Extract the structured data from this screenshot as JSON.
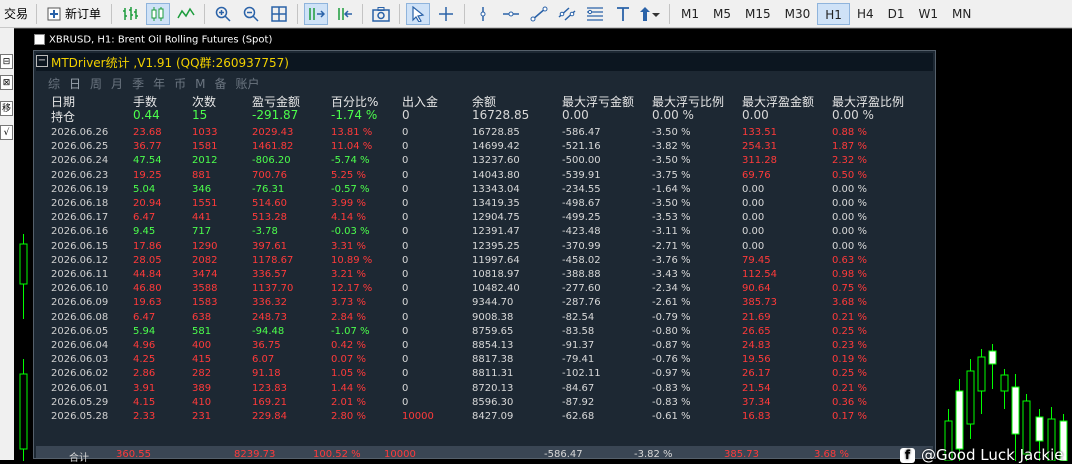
{
  "toolbar": {
    "trade_label": "交易",
    "new_order_label": "新订单",
    "timeframes": [
      "M1",
      "M5",
      "M15",
      "M30",
      "H1",
      "H4",
      "D1",
      "W1",
      "MN"
    ],
    "active_timeframe": "H1"
  },
  "left_strip": {
    "buttons": [
      "⊟",
      "⊠",
      "移",
      "√"
    ]
  },
  "chart": {
    "title": "XBRUSD, H1:  Brent Oil Rolling Futures (Spot)",
    "candle_up_color": "#00ff00",
    "candle_body_fill": "#ffffff"
  },
  "panel": {
    "title": "MTDriver统计 ,V1.91 (QQ群:260937757)",
    "tabs": [
      "综",
      "日",
      "周",
      "月",
      "季",
      "年",
      "币",
      "M",
      "备",
      "账户"
    ],
    "active_tab": "日",
    "headers": [
      "日期",
      "手数",
      "次数",
      "盈亏金额",
      "百分比%",
      "出入金",
      "余额",
      "最大浮亏金额",
      "最大浮亏比例",
      "最大浮盈金额",
      "最大浮盈比例"
    ],
    "holding": {
      "label": "持仓",
      "lots": "0.44",
      "trades": "15",
      "pnl": "-291.87",
      "pct": "-1.74 %",
      "deposit": "0",
      "balance": "16728.85",
      "max_loss": "0.00",
      "max_loss_pct": "0.00 %",
      "max_profit": "0.00",
      "max_profit_pct": "0.00 %"
    },
    "rows": [
      {
        "date": "2026.06.26",
        "lots": "23.68",
        "trades": "1033",
        "pnl": "2029.43",
        "pct": "13.81 %",
        "deposit": "0",
        "balance": "16728.85",
        "max_loss": "-586.47",
        "max_loss_pct": "-3.50 %",
        "max_profit": "133.51",
        "max_profit_pct": "0.88 %",
        "positive": true
      },
      {
        "date": "2026.06.25",
        "lots": "36.77",
        "trades": "1581",
        "pnl": "1461.82",
        "pct": "11.04 %",
        "deposit": "0",
        "balance": "14699.42",
        "max_loss": "-521.16",
        "max_loss_pct": "-3.82 %",
        "max_profit": "254.31",
        "max_profit_pct": "1.87 %",
        "positive": true
      },
      {
        "date": "2026.06.24",
        "lots": "47.54",
        "trades": "2012",
        "pnl": "-806.20",
        "pct": "-5.74 %",
        "deposit": "0",
        "balance": "13237.60",
        "max_loss": "-500.00",
        "max_loss_pct": "-3.50 %",
        "max_profit": "311.28",
        "max_profit_pct": "2.32 %",
        "positive": false
      },
      {
        "date": "2026.06.23",
        "lots": "19.25",
        "trades": "881",
        "pnl": "700.76",
        "pct": "5.25 %",
        "deposit": "0",
        "balance": "14043.80",
        "max_loss": "-539.91",
        "max_loss_pct": "-3.75 %",
        "max_profit": "69.76",
        "max_profit_pct": "0.50 %",
        "positive": true
      },
      {
        "date": "2026.06.19",
        "lots": "5.04",
        "trades": "346",
        "pnl": "-76.31",
        "pct": "-0.57 %",
        "deposit": "0",
        "balance": "13343.04",
        "max_loss": "-234.55",
        "max_loss_pct": "-1.64 %",
        "max_profit": "0.00",
        "max_profit_pct": "0.00 %",
        "positive": false
      },
      {
        "date": "2026.06.18",
        "lots": "20.94",
        "trades": "1551",
        "pnl": "514.60",
        "pct": "3.99 %",
        "deposit": "0",
        "balance": "13419.35",
        "max_loss": "-498.67",
        "max_loss_pct": "-3.50 %",
        "max_profit": "0.00",
        "max_profit_pct": "0.00 %",
        "positive": true
      },
      {
        "date": "2026.06.17",
        "lots": "6.47",
        "trades": "441",
        "pnl": "513.28",
        "pct": "4.14 %",
        "deposit": "0",
        "balance": "12904.75",
        "max_loss": "-499.25",
        "max_loss_pct": "-3.53 %",
        "max_profit": "0.00",
        "max_profit_pct": "0.00 %",
        "positive": true
      },
      {
        "date": "2026.06.16",
        "lots": "9.45",
        "trades": "717",
        "pnl": "-3.78",
        "pct": "-0.03 %",
        "deposit": "0",
        "balance": "12391.47",
        "max_loss": "-423.48",
        "max_loss_pct": "-3.11 %",
        "max_profit": "0.00",
        "max_profit_pct": "0.00 %",
        "positive": false
      },
      {
        "date": "2026.06.15",
        "lots": "17.86",
        "trades": "1290",
        "pnl": "397.61",
        "pct": "3.31 %",
        "deposit": "0",
        "balance": "12395.25",
        "max_loss": "-370.99",
        "max_loss_pct": "-2.71 %",
        "max_profit": "0.00",
        "max_profit_pct": "0.00 %",
        "positive": true
      },
      {
        "date": "2026.06.12",
        "lots": "28.05",
        "trades": "2082",
        "pnl": "1178.67",
        "pct": "10.89 %",
        "deposit": "0",
        "balance": "11997.64",
        "max_loss": "-458.02",
        "max_loss_pct": "-3.76 %",
        "max_profit": "79.45",
        "max_profit_pct": "0.63 %",
        "positive": true
      },
      {
        "date": "2026.06.11",
        "lots": "44.84",
        "trades": "3474",
        "pnl": "336.57",
        "pct": "3.21 %",
        "deposit": "0",
        "balance": "10818.97",
        "max_loss": "-388.88",
        "max_loss_pct": "-3.43 %",
        "max_profit": "112.54",
        "max_profit_pct": "0.98 %",
        "positive": true
      },
      {
        "date": "2026.06.10",
        "lots": "46.80",
        "trades": "3588",
        "pnl": "1137.70",
        "pct": "12.17 %",
        "deposit": "0",
        "balance": "10482.40",
        "max_loss": "-277.60",
        "max_loss_pct": "-2.34 %",
        "max_profit": "90.64",
        "max_profit_pct": "0.75 %",
        "positive": true
      },
      {
        "date": "2026.06.09",
        "lots": "19.63",
        "trades": "1583",
        "pnl": "336.32",
        "pct": "3.73 %",
        "deposit": "0",
        "balance": "9344.70",
        "max_loss": "-287.76",
        "max_loss_pct": "-2.61 %",
        "max_profit": "385.73",
        "max_profit_pct": "3.68 %",
        "positive": true
      },
      {
        "date": "2026.06.08",
        "lots": "6.47",
        "trades": "638",
        "pnl": "248.73",
        "pct": "2.84 %",
        "deposit": "0",
        "balance": "9008.38",
        "max_loss": "-82.54",
        "max_loss_pct": "-0.79 %",
        "max_profit": "21.69",
        "max_profit_pct": "0.21 %",
        "positive": true
      },
      {
        "date": "2026.06.05",
        "lots": "5.94",
        "trades": "581",
        "pnl": "-94.48",
        "pct": "-1.07 %",
        "deposit": "0",
        "balance": "8759.65",
        "max_loss": "-83.58",
        "max_loss_pct": "-0.80 %",
        "max_profit": "26.65",
        "max_profit_pct": "0.25 %",
        "positive": false
      },
      {
        "date": "2026.06.04",
        "lots": "4.96",
        "trades": "400",
        "pnl": "36.75",
        "pct": "0.42 %",
        "deposit": "0",
        "balance": "8854.13",
        "max_loss": "-91.37",
        "max_loss_pct": "-0.87 %",
        "max_profit": "24.83",
        "max_profit_pct": "0.23 %",
        "positive": true
      },
      {
        "date": "2026.06.03",
        "lots": "4.25",
        "trades": "415",
        "pnl": "6.07",
        "pct": "0.07 %",
        "deposit": "0",
        "balance": "8817.38",
        "max_loss": "-79.41",
        "max_loss_pct": "-0.76 %",
        "max_profit": "19.56",
        "max_profit_pct": "0.19 %",
        "positive": true
      },
      {
        "date": "2026.06.02",
        "lots": "2.86",
        "trades": "282",
        "pnl": "91.18",
        "pct": "1.05 %",
        "deposit": "0",
        "balance": "8811.31",
        "max_loss": "-102.11",
        "max_loss_pct": "-0.97 %",
        "max_profit": "26.17",
        "max_profit_pct": "0.25 %",
        "positive": true
      },
      {
        "date": "2026.06.01",
        "lots": "3.91",
        "trades": "389",
        "pnl": "123.83",
        "pct": "1.44 %",
        "deposit": "0",
        "balance": "8720.13",
        "max_loss": "-84.67",
        "max_loss_pct": "-0.83 %",
        "max_profit": "21.54",
        "max_profit_pct": "0.21 %",
        "positive": true
      },
      {
        "date": "2026.05.29",
        "lots": "4.15",
        "trades": "410",
        "pnl": "169.21",
        "pct": "2.01 %",
        "deposit": "0",
        "balance": "8596.30",
        "max_loss": "-87.92",
        "max_loss_pct": "-0.83 %",
        "max_profit": "37.34",
        "max_profit_pct": "0.36 %",
        "positive": true
      },
      {
        "date": "2026.05.28",
        "lots": "2.33",
        "trades": "231",
        "pnl": "229.84",
        "pct": "2.80 %",
        "deposit": "10000",
        "balance": "8427.09",
        "max_loss": "-62.68",
        "max_loss_pct": "-0.61 %",
        "max_profit": "16.83",
        "max_profit_pct": "0.17 %",
        "positive": true
      }
    ],
    "summary": {
      "label": "合计",
      "lots": "360.55",
      "pnl": "8239.73",
      "pct": "100.52 %",
      "deposit": "10000",
      "max_loss": "-586.47",
      "max_loss_pct": "-3.82 %",
      "max_profit": "385.73",
      "max_profit_pct": "3.68 %"
    }
  },
  "watermark": {
    "text": "@Good Luck Jackie"
  }
}
